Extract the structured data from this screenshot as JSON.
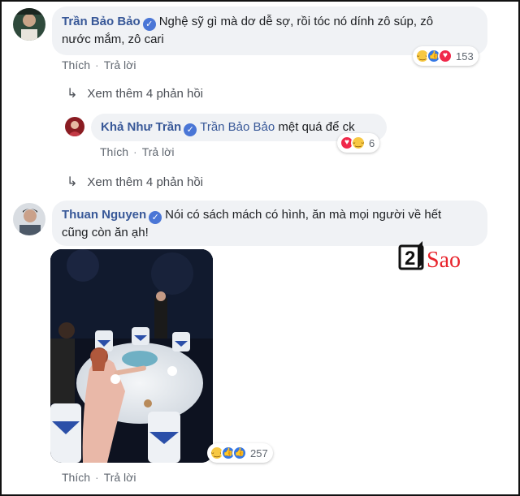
{
  "comments": [
    {
      "author": "Trần Bảo Bảo",
      "text_line1": "Nghệ sỹ gì mà dơ dễ sợ, rồi tóc nó dính zô súp, zô",
      "text_line2": "nước mắm, zô cari",
      "actions": [
        "Thích",
        "Trả lời"
      ],
      "reactions": {
        "icons": [
          "haha-icon",
          "like-icon",
          "love-icon"
        ],
        "count": "153"
      }
    },
    {
      "author": "Thuan Nguyen",
      "text_line1": "Nói có sách mách có hình, ăn mà mọi người về hết",
      "text_line2": "cũng còn ăn ạh!",
      "actions": [
        "Thích",
        "Trả lời"
      ],
      "reactions": {
        "icons": [
          "haha-icon",
          "like-icon",
          "like-icon"
        ],
        "count": "257"
      }
    }
  ],
  "reply": {
    "author": "Khả Như Trần",
    "mention": "Trần Bảo Bảo",
    "text": "mệt quá để ck",
    "actions": [
      "Thích",
      "Trả lời"
    ],
    "reactions": {
      "icons": [
        "love-icon",
        "haha-icon"
      ],
      "count": "6"
    }
  },
  "more_replies": [
    "Xem thêm 4 phản hồi",
    "Xem thêm 4 phản hồi"
  ],
  "watermark": {
    "digit": "2",
    "word": "Sao"
  },
  "colors": {
    "author": "#385898",
    "bubble": "#f0f2f5",
    "like": "#3578e5",
    "love": "#f0284a",
    "haha": "#f7c843",
    "watermark": "#e8232b"
  }
}
